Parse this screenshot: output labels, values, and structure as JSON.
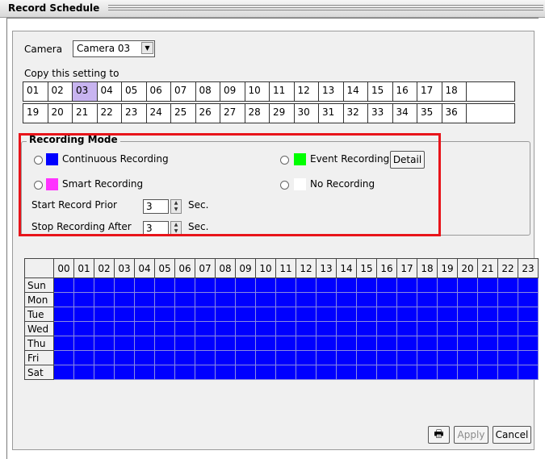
{
  "window": {
    "title": "Record Schedule"
  },
  "camera": {
    "label": "Camera",
    "selected": "Camera 03"
  },
  "copy": {
    "label": "Copy this setting to",
    "row1": [
      "01",
      "02",
      "03",
      "04",
      "05",
      "06",
      "07",
      "08",
      "09",
      "10",
      "11",
      "12",
      "13",
      "14",
      "15",
      "16",
      "17",
      "18",
      ""
    ],
    "row2": [
      "19",
      "20",
      "21",
      "22",
      "23",
      "24",
      "25",
      "26",
      "27",
      "28",
      "29",
      "30",
      "31",
      "32",
      "33",
      "34",
      "35",
      "36",
      ""
    ],
    "selected": "03"
  },
  "recording_mode": {
    "legend": "Recording Mode",
    "continuous": {
      "label": "Continuous Recording",
      "color": "#0000ff"
    },
    "smart": {
      "label": "Smart Recording",
      "color": "#ff33ff"
    },
    "event": {
      "label": "Event Recording",
      "color": "#00ff00",
      "detail_label": "Detail"
    },
    "none": {
      "label": "No Recording",
      "color": "#ffffff"
    },
    "start_prior": {
      "label": "Start Record Prior",
      "value": "3",
      "unit": "Sec."
    },
    "stop_after": {
      "label": "Stop Recording After",
      "value": "3",
      "unit": "Sec."
    }
  },
  "schedule": {
    "hours": [
      "00",
      "01",
      "02",
      "03",
      "04",
      "05",
      "06",
      "07",
      "08",
      "09",
      "10",
      "11",
      "12",
      "13",
      "14",
      "15",
      "16",
      "17",
      "18",
      "19",
      "20",
      "21",
      "22",
      "23"
    ],
    "days": [
      "Sun",
      "Mon",
      "Tue",
      "Wed",
      "Thu",
      "Fri",
      "Sat"
    ],
    "fill_mode": "continuous",
    "fill_color": "#0000ff"
  },
  "footer": {
    "printer_icon": "printer-icon",
    "apply_label": "Apply",
    "cancel_label": "Cancel"
  }
}
